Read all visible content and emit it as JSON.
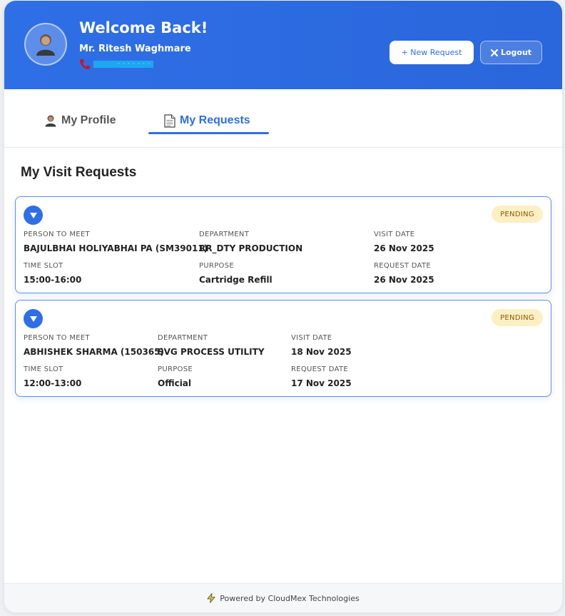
{
  "header": {
    "welcome": "Welcome Back!",
    "user_name": "Mr. Ritesh Waghmare",
    "phone_masked": "· · · · · · ·",
    "new_request_label": "+ New Request",
    "logout_label": "Logout",
    "brand_color": "#2f6fe6"
  },
  "tabs": [
    {
      "label": "My Profile",
      "icon": "user-icon",
      "active": false
    },
    {
      "label": "My Requests",
      "icon": "document-icon",
      "active": true
    }
  ],
  "section_title": "My Visit Requests",
  "requests": [
    {
      "status": "PENDING",
      "person_label": "PERSON TO MEET",
      "person": "BAJULBHAI HOLIYABHAI PA (SM39011)",
      "department_label": "DEPARTMENT",
      "department": "RR_DTY PRODUCTION",
      "visit_date_label": "VISIT DATE",
      "visit_date": "26 Nov 2025",
      "time_slot_label": "TIME SLOT",
      "time_slot": "15:00-16:00",
      "purpose_label": "PURPOSE",
      "purpose": "Cartridge Refill",
      "request_date_label": "REQUEST DATE",
      "request_date": "26 Nov 2025"
    },
    {
      "status": "PENDING",
      "person_label": "PERSON TO MEET",
      "person": "ABHISHEK SHARMA (150365)",
      "department_label": "DEPARTMENT",
      "department": "SVG PROCESS UTILITY",
      "visit_date_label": "VISIT DATE",
      "visit_date": "18 Nov 2025",
      "time_slot_label": "TIME SLOT",
      "time_slot": "12:00-13:00",
      "purpose_label": "PURPOSE",
      "purpose": "Official",
      "request_date_label": "REQUEST DATE",
      "request_date": "17 Nov 2025"
    }
  ],
  "footer": {
    "text": "Powered by CloudMex Technologies"
  }
}
